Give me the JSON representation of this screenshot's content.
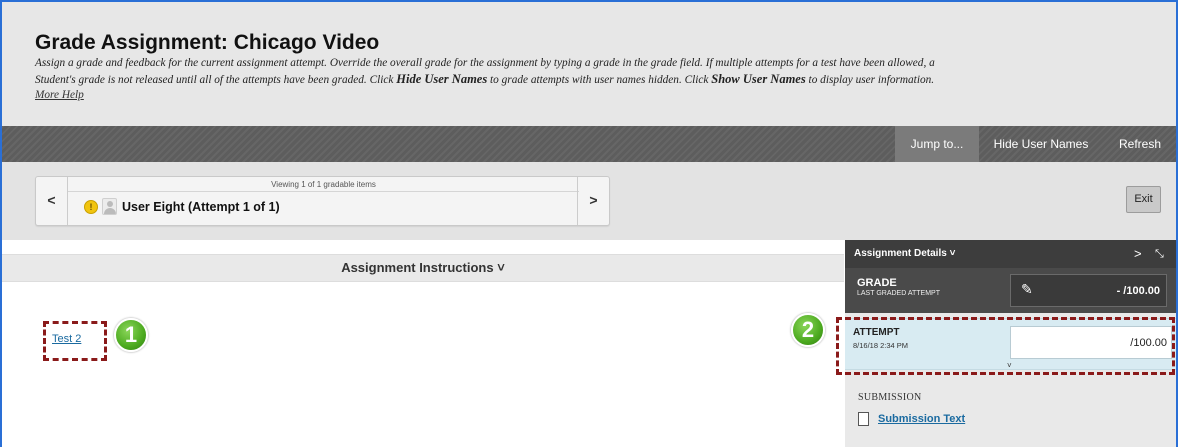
{
  "header": {
    "title": "Grade Assignment: Chicago Video",
    "description_line1": "Assign a grade and feedback for the current assignment attempt. Override the overall grade for the assignment by typing a grade in the grade field. If multiple attempts for a test have been allowed, a",
    "description_line2_a": "Student's grade is not released until all of the attempts have been graded. Click ",
    "hide_user_names_emph": "Hide User Names",
    "description_line2_b": " to grade attempts with user names hidden. Click ",
    "show_user_names_emph": "Show User Names",
    "description_line2_c": " to display user information.",
    "more_help": "More Help"
  },
  "toolbar": {
    "jump_to": "Jump to...",
    "hide_user_names": "Hide User Names",
    "refresh": "Refresh"
  },
  "pager": {
    "prev": "<",
    "next": ">",
    "viewing": "Viewing 1 of 1 gradable items",
    "status_icon": "!",
    "user": "User Eight (Attempt 1 of 1)"
  },
  "exit_label": "Exit",
  "instructions": {
    "label": "Assignment Instructions ˅",
    "link": "Test 2"
  },
  "badges": {
    "one": "1",
    "two": "2"
  },
  "panel": {
    "title": "Assignment Details ˅",
    "next": ">",
    "expand": "⤡",
    "grade_label": "GRADE",
    "grade_sub": "LAST GRADED ATTEMPT",
    "grade_value": "- /100.00",
    "attempt_label": "ATTEMPT",
    "attempt_date": "8/16/18 2:34 PM",
    "attempt_value": "/100.00",
    "attempt_chevron": "˅",
    "submission_label": "SUBMISSION",
    "submission_link": "Submission Text"
  },
  "colors": {
    "link": "#1a6aa0",
    "highlight_dash": "#8a1a1a",
    "badge_green": "#4caa1f",
    "attempt_bg": "#d8ebf2"
  }
}
